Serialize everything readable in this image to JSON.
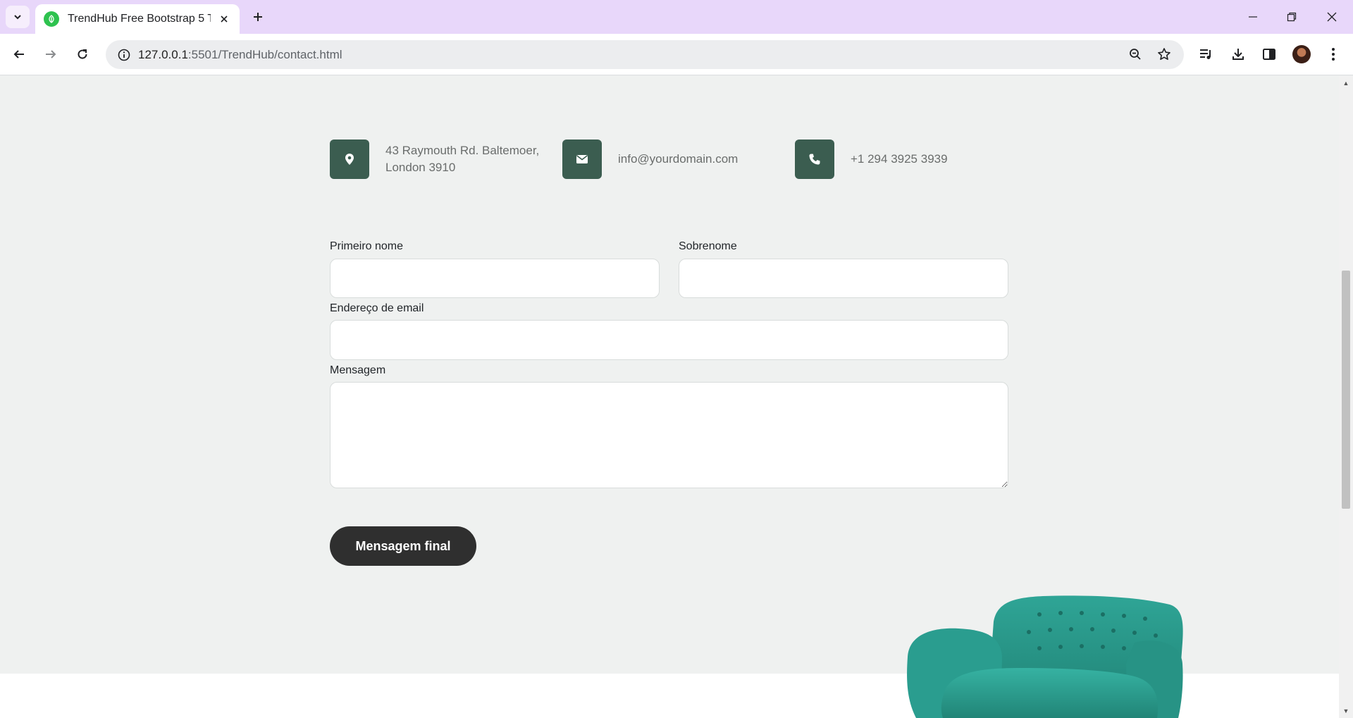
{
  "browser": {
    "tab_title": "TrendHub Free Bootstrap 5 Tem",
    "url_host": "127.0.0.1",
    "url_path": ":5501/TrendHub/contact.html"
  },
  "contact": {
    "address_line1": "43 Raymouth Rd. Baltemoer,",
    "address_line2": "London 3910",
    "email": "info@yourdomain.com",
    "phone": "+1 294 3925 3939"
  },
  "form": {
    "first_name_label": "Primeiro nome",
    "first_name_value": "",
    "last_name_label": "Sobrenome",
    "last_name_value": "",
    "email_label": "Endereço de email",
    "email_value": "",
    "message_label": "Mensagem",
    "message_value": "",
    "submit_label": "Mensagem final"
  },
  "colors": {
    "icon_box": "#3b5d50",
    "button": "#2f2f2f",
    "page_bg": "#eff1f0",
    "tabbar": "#e8d7fa",
    "chair": "#2a9d8f"
  },
  "icons": [
    "chevron-down-icon",
    "leaf-favicon-icon",
    "close-icon",
    "plus-icon",
    "minimize-icon",
    "restore-icon",
    "back-arrow-icon",
    "forward-arrow-icon",
    "reload-icon",
    "info-icon",
    "zoom-icon",
    "star-icon",
    "media-icon",
    "download-icon",
    "sidepanel-icon",
    "menu-icon",
    "map-pin-icon",
    "envelope-icon",
    "phone-icon"
  ]
}
